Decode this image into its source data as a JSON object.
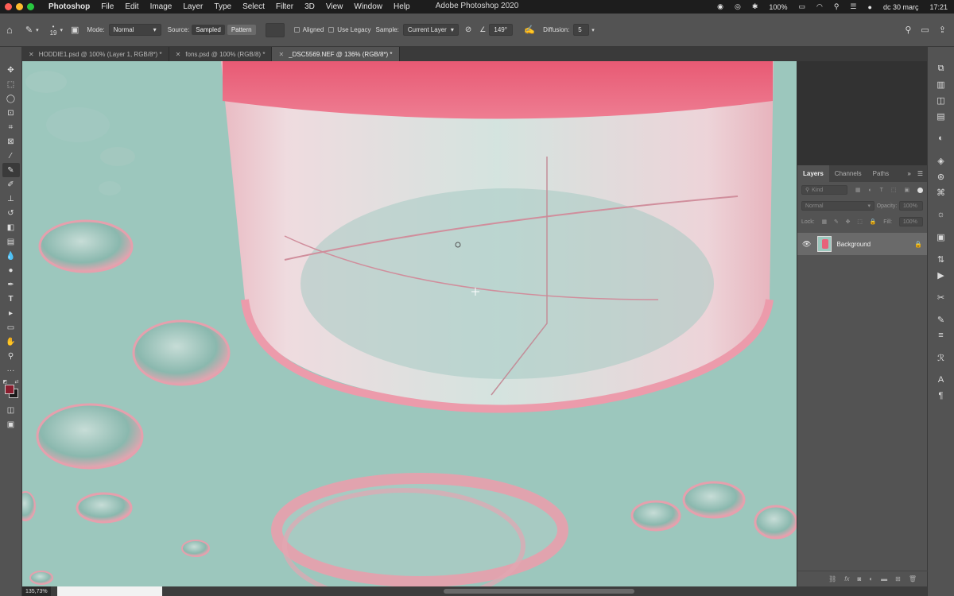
{
  "menubar": {
    "app_name": "Photoshop",
    "items": [
      "File",
      "Edit",
      "Image",
      "Layer",
      "Type",
      "Select",
      "Filter",
      "3D",
      "View",
      "Window",
      "Help"
    ],
    "window_title": "Adobe Photoshop 2020",
    "battery": "100%",
    "datetime": "dc 30 març",
    "time": "17:21",
    "traffic_colors": [
      "#ff5f57",
      "#febc2e",
      "#28c840"
    ]
  },
  "options": {
    "brush_size": "19",
    "mode_label": "Mode:",
    "mode_value": "Normal",
    "source_label": "Source:",
    "source_sampled": "Sampled",
    "source_pattern": "Pattern",
    "aligned_label": "Aligned",
    "legacy_label": "Use Legacy",
    "sample_label": "Sample:",
    "sample_value": "Current Layer",
    "angle_value": "149°",
    "diffusion_label": "Diffusion:",
    "diffusion_value": "5"
  },
  "tabs": [
    {
      "label": "HODDIE1.psd @ 100% (Layer 1, RGB/8*) *",
      "active": false
    },
    {
      "label": "fons.psd @ 100% (RGB/8) *",
      "active": false
    },
    {
      "label": "_DSC5569.NEF @ 136% (RGB/8*) *",
      "active": true
    }
  ],
  "layers_panel": {
    "tabs": [
      "Layers",
      "Channels",
      "Paths"
    ],
    "kind_placeholder": "Kind",
    "blend_mode": "Normal",
    "opacity_label": "Opacity:",
    "opacity_value": "100%",
    "lock_label": "Lock:",
    "fill_label": "Fill:",
    "fill_value": "100%",
    "layer_name": "Background"
  },
  "status": {
    "zoom": "135,73%"
  },
  "colors": {
    "foreground": "#8a1d2e",
    "background": "#1a1a1a",
    "canvas_bg": "#9cc7bd",
    "glass_pink": "#e8617a"
  }
}
